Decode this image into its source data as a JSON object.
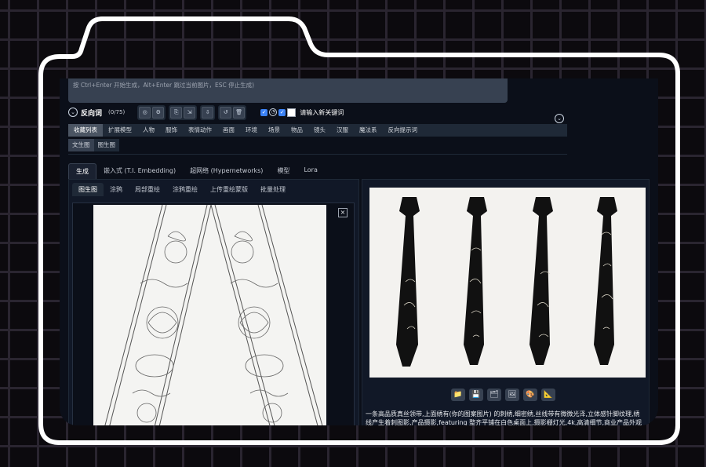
{
  "prompt": {
    "placeholder": "按 Ctrl+Enter 开始生成，Alt+Enter 跳过当前图片，ESC 停止生成)"
  },
  "negative": {
    "label": "反向词",
    "count": "(0/75)",
    "keyword_placeholder": "请输入新关键词"
  },
  "tagbar": {
    "items": [
      "收藏列表",
      "扩展模型",
      "人物",
      "服饰",
      "表情动作",
      "画面",
      "环境",
      "场景",
      "物品",
      "镜头",
      "汉服",
      "魔法系",
      "反向提示词"
    ]
  },
  "subtags": {
    "items": [
      "文生图",
      "图生图"
    ]
  },
  "main_tabs": {
    "items": [
      "生成",
      "嵌入式 (T.I. Embedding)",
      "超网络 (Hypernetworks)",
      "模型",
      "Lora"
    ]
  },
  "img_tabs": {
    "items": [
      "图生图",
      "涂鸦",
      "局部重绘",
      "涂鸦重绘",
      "上传重绘蒙版",
      "批量处理"
    ]
  },
  "output": {
    "caption": "一条高品质真丝领带,上面绣有(你的图案图片) 的刺绣,细密绣,丝线带有微微光泽,立体感针脚纹理,绣线产生着刺图影,产品摄影,featuring 整齐平铺在白色桌面上,摄影棚灯光,4k,高清细节,商业产品外观"
  },
  "icons": {
    "toolbar": [
      "folder-icon",
      "save-icon",
      "zip-icon",
      "image-icon",
      "palette-icon",
      "ruler-icon"
    ]
  },
  "colors": {
    "accent": "#3b82f6",
    "background": "#0b0f19",
    "panel": "#111827"
  }
}
